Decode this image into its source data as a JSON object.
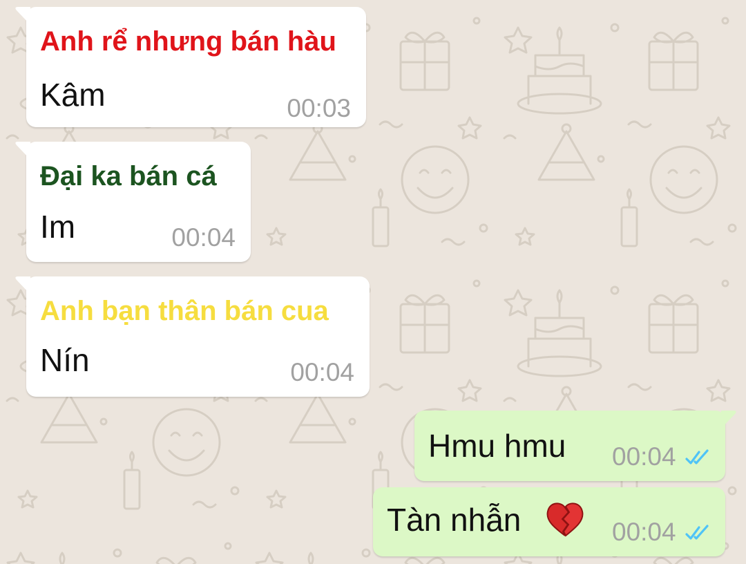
{
  "colors": {
    "background": "#ece5dd",
    "incoming_bubble": "#ffffff",
    "outgoing_bubble": "#dcf8c6",
    "timestamp": "#a1a1a1",
    "read_ticks": "#4fc3f7"
  },
  "messages": [
    {
      "direction": "incoming",
      "sender": "Anh rể nhưng bán hàu",
      "sender_color": "#e0141a",
      "text": "Kâm",
      "time": "00:03"
    },
    {
      "direction": "incoming",
      "sender": "Đại ka bán cá",
      "sender_color": "#1c5420",
      "text": "Im",
      "time": "00:04"
    },
    {
      "direction": "incoming",
      "sender": "Anh bạn thân bán cua",
      "sender_color": "#f6dd3f",
      "text": "Nín",
      "time": "00:04"
    },
    {
      "direction": "outgoing",
      "text": "Hmu hmu",
      "time": "00:04",
      "status_icon": "double-check-icon"
    },
    {
      "direction": "outgoing",
      "text": "Tàn nhẫn",
      "emoji": "broken-heart-icon",
      "time": "00:04",
      "status_icon": "double-check-icon"
    }
  ]
}
